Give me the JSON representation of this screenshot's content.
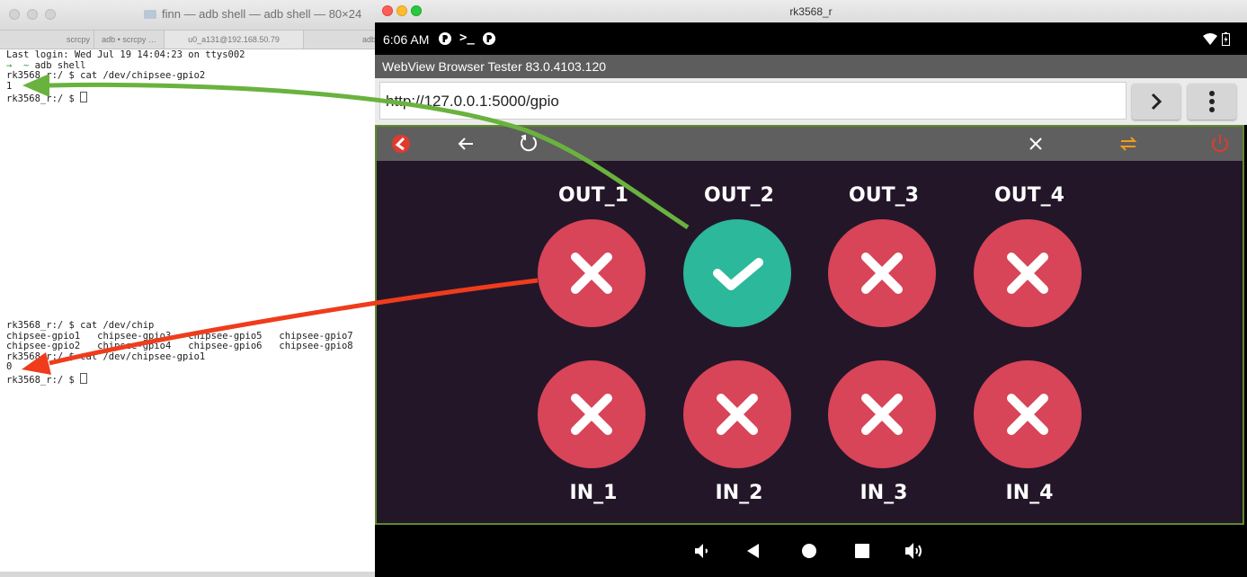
{
  "terminal_top": {
    "window_title": "finn — adb shell — adb shell — 80×24",
    "tabs": [
      "scrcpy",
      "adb • scrcpy …",
      "u0_a131@192.168.50.79",
      "adb"
    ],
    "lines": {
      "l1": "Last login: Wed Jul 19 14:04:23 on ttys002",
      "l2_prompt": "→  ~ ",
      "l2_cmd": "adb shell",
      "l3": "rk3568_r:/ $ cat /dev/chipsee-gpio2",
      "l4": "1",
      "l5": "rk3568_r:/ $ "
    }
  },
  "terminal_bottom": {
    "lines": {
      "l1": "rk3568_r:/ $ cat /dev/chip",
      "l2": "chipsee-gpio1   chipsee-gpio3   chipsee-gpio5   chipsee-gpio7",
      "l3": "chipsee-gpio2   chipsee-gpio4   chipsee-gpio6   chipsee-gpio8",
      "l4": "rk3568_r:/ $ cat /dev/chipsee-gpio1",
      "l5": "0",
      "l6": "rk3568_r:/ $ "
    }
  },
  "android": {
    "window_title": "rk3568_r",
    "status_time": "6:06 AM",
    "app_title": "WebView Browser Tester 83.0.4103.120",
    "url": "http://127.0.0.1:5000/gpio",
    "outputs": [
      {
        "label": "OUT_1",
        "state": "off"
      },
      {
        "label": "OUT_2",
        "state": "on"
      },
      {
        "label": "OUT_3",
        "state": "off"
      },
      {
        "label": "OUT_4",
        "state": "off"
      }
    ],
    "inputs": [
      {
        "label": "IN_1",
        "state": "off"
      },
      {
        "label": "IN_2",
        "state": "off"
      },
      {
        "label": "IN_3",
        "state": "off"
      },
      {
        "label": "IN_4",
        "state": "off"
      }
    ],
    "colors": {
      "off": "#d84458",
      "on": "#2cb89a",
      "background": "#241629",
      "toolbar": "#5f5f5f",
      "accent_orange": "#f29b1d",
      "power_red": "#e03b2e"
    }
  },
  "annotations": {
    "green_arrow_color": "#6ab23e",
    "red_arrow_color": "#ef3c1c"
  }
}
